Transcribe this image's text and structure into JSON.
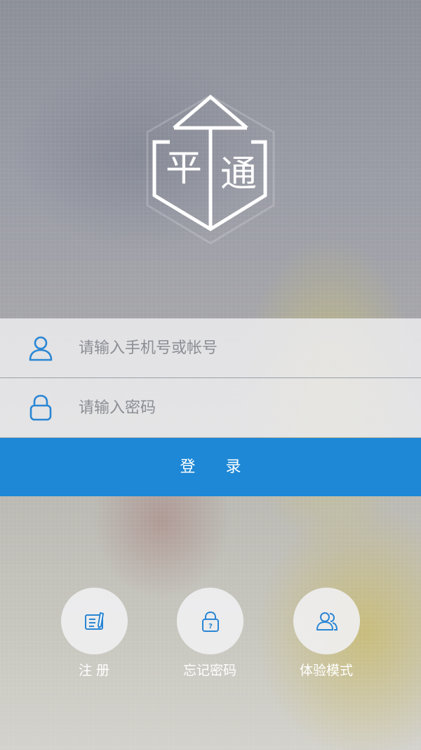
{
  "logo": {
    "char_left": "平",
    "char_right": "通"
  },
  "login_form": {
    "username_placeholder": "请输入手机号或帐号",
    "password_placeholder": "请输入密码",
    "username_icon": "user-icon",
    "password_icon": "lock-icon",
    "login_label": "登 录"
  },
  "actions": {
    "register": {
      "label": "注 册",
      "icon": "register-icon"
    },
    "forgot_password": {
      "label": "忘记密码",
      "icon": "lock-question-icon"
    },
    "trial_mode": {
      "label": "体验模式",
      "icon": "users-icon"
    }
  },
  "colors": {
    "accent": "#1e88d6",
    "icon": "#2a86d4",
    "field_background": "#ebebed",
    "placeholder": "#8b8e94"
  }
}
